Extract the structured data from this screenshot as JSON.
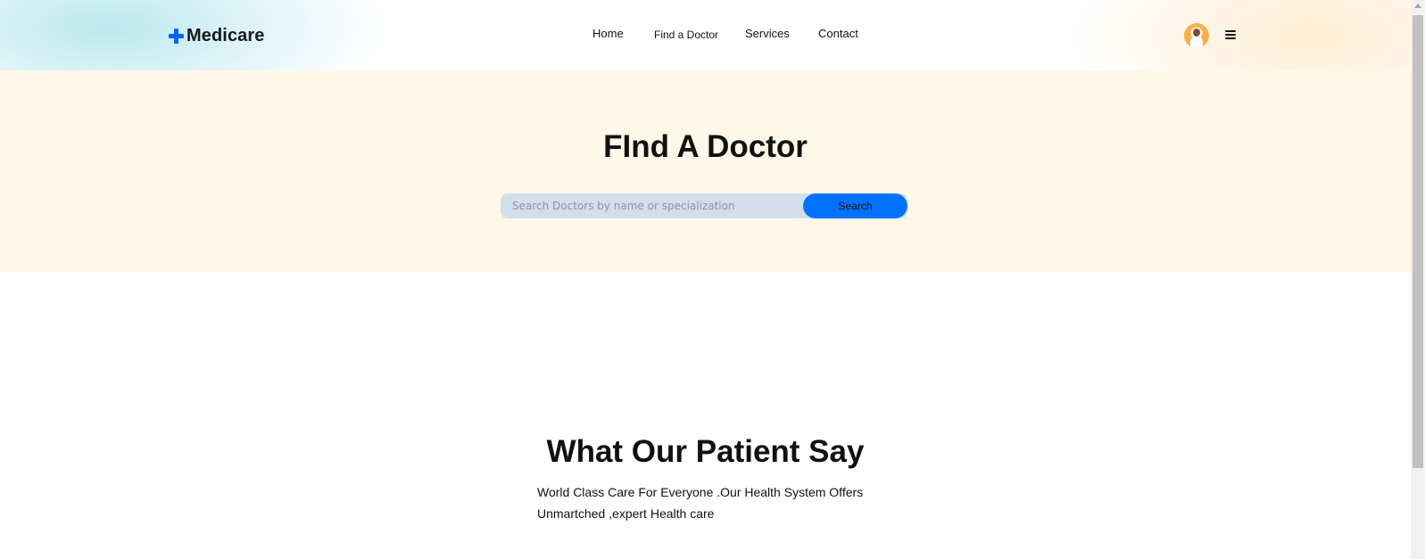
{
  "brand": {
    "name": "Medicare",
    "icon": "plus-cross-icon",
    "accent_color": "#0066ff"
  },
  "nav": {
    "home": "Home",
    "find_doctor": "Find a Doctor",
    "services": "Services",
    "contact": "Contact"
  },
  "header": {
    "avatar_icon": "doctor-avatar",
    "menu_icon": "hamburger-menu-icon"
  },
  "hero": {
    "title": "FInd A Doctor",
    "search_placeholder": "Search Doctors by name or specialization",
    "search_value": "",
    "search_button": "Search",
    "button_color": "#0072ff",
    "background_color": "#fff8e8"
  },
  "testimonials": {
    "title": "What Our Patient Say",
    "description_line1": "World Class Care For Everyone .Our Health System Offers",
    "description_line2": "Unmartched ,expert Health care"
  }
}
